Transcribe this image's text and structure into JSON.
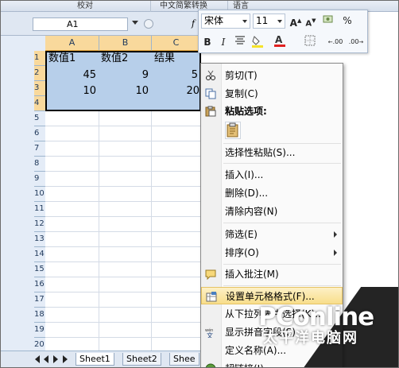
{
  "ribbon": {
    "group_review": "校对",
    "group_convert": "中文简繁转换",
    "group_language": "语言"
  },
  "name_box": {
    "value": "A1"
  },
  "formula_bar": {
    "fx_label": "f"
  },
  "columns": [
    "A",
    "B",
    "C"
  ],
  "rows": [
    "1",
    "2",
    "3",
    "4",
    "5",
    "6",
    "7",
    "8",
    "9",
    "10",
    "11",
    "12",
    "13",
    "14",
    "15",
    "16",
    "17",
    "18",
    "19",
    "20",
    "21"
  ],
  "cells": {
    "A1": "数值1",
    "B1": "数值2",
    "C1": "结果",
    "A2": "45",
    "B2": "9",
    "C2": "5",
    "A3": "10",
    "B3": "10",
    "C3": "20"
  },
  "sheet_tabs": [
    "Sheet1",
    "Sheet2",
    "Shee"
  ],
  "mini_toolbar": {
    "font": "宋体",
    "size": "11",
    "grow_font": "A",
    "shrink_font": "A",
    "currency": "",
    "percent": "%",
    "bold": "B",
    "italic": "I",
    "font_color": "A",
    "increase_decimal": ".00",
    "decrease_decimal": ".00",
    "fill_color": "#f5e32a",
    "font_color_bar": "#e02020"
  },
  "context_menu": {
    "items": [
      {
        "label": "剪切(T)",
        "icon": "scissors-icon"
      },
      {
        "label": "复制(C)",
        "icon": "copy-icon"
      },
      {
        "label": "粘贴选项:",
        "icon": "clipboard-icon"
      },
      {
        "label": "选择性粘贴(S)..."
      },
      {
        "label": "插入(I)..."
      },
      {
        "label": "删除(D)..."
      },
      {
        "label": "清除内容(N)"
      },
      {
        "label": "筛选(E)"
      },
      {
        "label": "排序(O)"
      },
      {
        "label": "插入批注(M)",
        "icon": "comment-icon"
      },
      {
        "label": "设置单元格格式(F)...",
        "icon": "format-cells-icon"
      },
      {
        "label": "从下拉列表中选择(K)..."
      },
      {
        "label": "显示拼音字段(S)",
        "icon": "phonetic-icon"
      },
      {
        "label": "定义名称(A)..."
      },
      {
        "label": "超链接(I)...",
        "icon": "hyperlink-icon"
      }
    ]
  },
  "watermark": {
    "brand": "PConline",
    "brand_cn": "太平洋电脑网"
  }
}
